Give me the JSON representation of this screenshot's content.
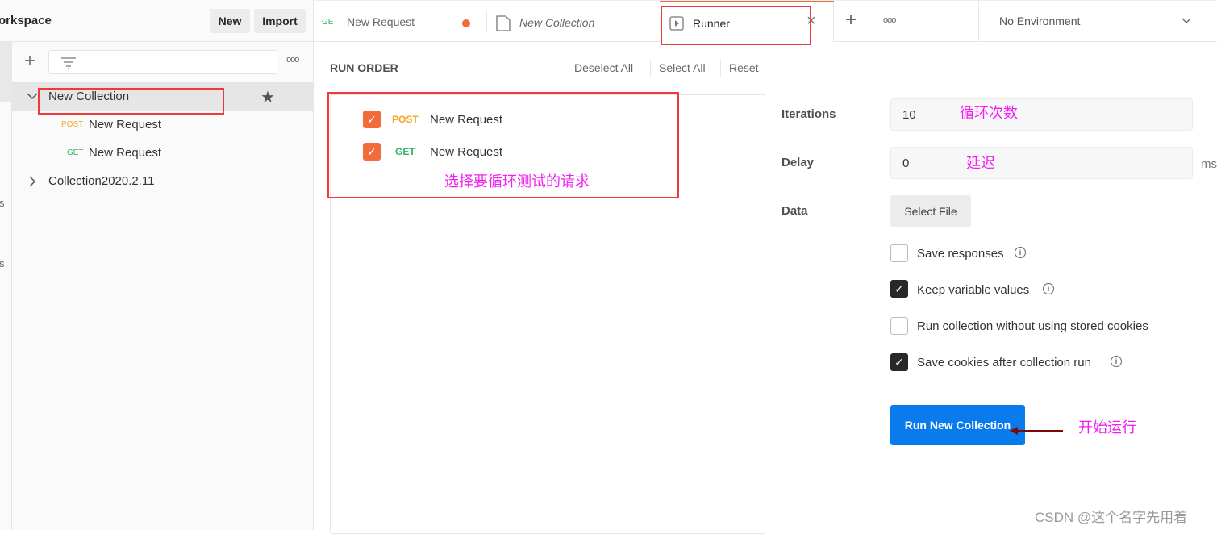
{
  "sidebar": {
    "workspace_title": "orkspace",
    "new_label": "New",
    "import_label": "Import",
    "edge_fragments": [
      "s",
      "s"
    ],
    "filter_placeholder": "",
    "collections": [
      {
        "name": "New Collection",
        "expanded": true,
        "starred": true,
        "requests": [
          {
            "method": "POST",
            "name": "New Request"
          },
          {
            "method": "GET",
            "name": "New Request"
          }
        ]
      },
      {
        "name": "Collection2020.2.11",
        "expanded": false
      }
    ]
  },
  "tabs": [
    {
      "method": "GET",
      "label": "New Request",
      "unsaved": true
    },
    {
      "label": "New Collection",
      "icon": "collection-icon"
    },
    {
      "label": "Runner",
      "icon": "runner-icon",
      "active": true
    }
  ],
  "environment": {
    "selected": "No Environment"
  },
  "run_order": {
    "title": "RUN ORDER",
    "deselect_all": "Deselect All",
    "select_all": "Select All",
    "reset": "Reset",
    "items": [
      {
        "method": "POST",
        "name": "New Request",
        "checked": true
      },
      {
        "method": "GET",
        "name": "New Request",
        "checked": true
      }
    ]
  },
  "settings": {
    "iterations_label": "Iterations",
    "iterations_value": "10",
    "delay_label": "Delay",
    "delay_value": "0",
    "delay_unit": "ms",
    "data_label": "Data",
    "select_file": "Select File",
    "options": [
      {
        "label": "Save responses",
        "checked": false,
        "info": true
      },
      {
        "label": "Keep variable values",
        "checked": true,
        "info": true
      },
      {
        "label": "Run collection without using stored cookies",
        "checked": false,
        "info": false
      },
      {
        "label": "Save cookies after collection run",
        "checked": true,
        "info": true
      }
    ],
    "run_button": "Run New Collection"
  },
  "annotations": {
    "iterations": "循环次数",
    "delay": "延迟",
    "select_requests": "选择要循环测试的请求",
    "start": "开始运行"
  },
  "watermark": "CSDN @这个名字先用着",
  "colors": {
    "accent": "#f26b3a",
    "run_button": "#097bed",
    "post": "#f4a623",
    "get": "#2eb761",
    "annotation": "#f01ef0",
    "highlight": "#f03a3a"
  }
}
